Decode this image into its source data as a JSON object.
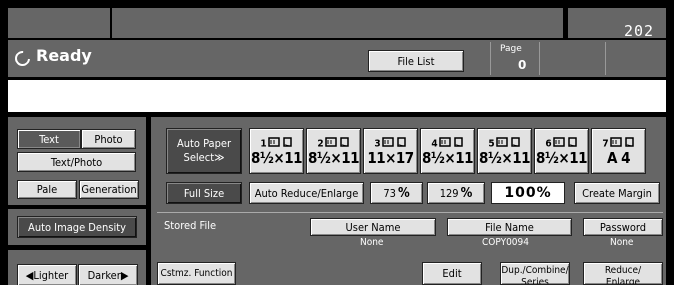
{
  "header": {
    "counter": "202",
    "status": "Ready",
    "file_list_label": "File List",
    "page_label": "Page",
    "page_value": "0"
  },
  "message_line": "",
  "left": {
    "text_label": "Text",
    "photo_label": "Photo",
    "text_photo_label": "Text/Photo",
    "pale_label": "Pale",
    "generation_label": "Generation",
    "auto_density_label": "Auto Image Density",
    "lighter_label": "Lighter",
    "darker_label": "Darker"
  },
  "paper": {
    "auto_select_line1": "Auto Paper",
    "auto_select_line2": "Select",
    "trays": [
      {
        "num": "1",
        "size": "8½×11"
      },
      {
        "num": "2",
        "size": "8½×11"
      },
      {
        "num": "3",
        "size": "11×17"
      },
      {
        "num": "4",
        "size": "8½×11"
      },
      {
        "num": "5",
        "size": "8½×11"
      },
      {
        "num": "6",
        "size": "8½×11"
      },
      {
        "num": "7",
        "size": "A 4"
      }
    ]
  },
  "ratio": {
    "full_size": "Full Size",
    "auto_reduce": "Auto Reduce/Enlarge",
    "r73": "73",
    "r129": "129",
    "pct": "%",
    "current": "100%",
    "create_margin": "Create Margin"
  },
  "stored": {
    "label": "Stored File",
    "user_name_label": "User Name",
    "user_name_value": "None",
    "file_name_label": "File Name",
    "file_name_value": "COPY0094",
    "password_label": "Password",
    "password_value": "None"
  },
  "bottom": {
    "custom_function": "Cstmz. Function",
    "edit": "Edit",
    "dup_combine_line1": "Dup./Combine/",
    "dup_combine_line2": "Series",
    "reduce_line1": "Reduce/",
    "reduce_line2": "Enlarge"
  }
}
